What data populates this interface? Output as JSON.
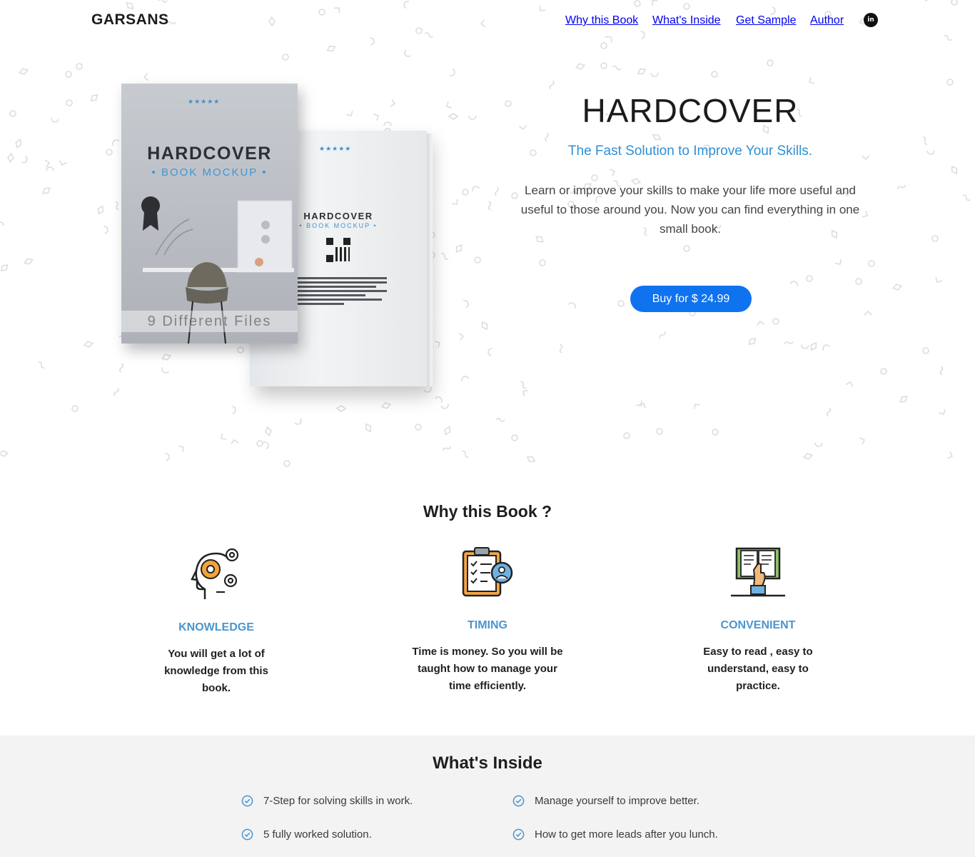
{
  "header": {
    "brand": "GARSANS",
    "nav": [
      "Why this Book",
      "What's Inside",
      "Get Sample",
      "Author"
    ],
    "social_icon": "linkedin-icon"
  },
  "hero": {
    "title": "HARDCOVER",
    "tagline": "The Fast Solution to Improve Your Skills.",
    "description": "Learn or improve your skills to make your life more useful and useful to those around you. Now you can find everything in one small book.",
    "buy_label": "Buy for $ 24.99",
    "accent": "#2f8fd6",
    "button_color": "#0f73ef",
    "book": {
      "front_title": "HARDCOVER",
      "front_sub": "• BOOK MOCKUP •",
      "front_files": "9 Different Files",
      "back_title": "HARDCOVER",
      "back_sub": "• BOOK MOCKUP •",
      "stars": "★★★★★"
    }
  },
  "why": {
    "title": "Why this Book ?",
    "features": [
      {
        "icon": "head-gears-icon",
        "title": "KNOWLEDGE",
        "desc": "You will get a lot of knowledge from this book."
      },
      {
        "icon": "clipboard-checklist-icon",
        "title": "TIMING",
        "desc": "Time is money. So you will be taught how to manage your time efficiently."
      },
      {
        "icon": "book-reading-icon",
        "title": "CONVENIENT",
        "desc": "Easy to read , easy to understand, easy to practice."
      }
    ]
  },
  "inside": {
    "title": "What's Inside",
    "items": [
      "7-Step for solving skills in work.",
      "Manage yourself to improve better.",
      "5 fully worked solution.",
      "How to get more leads after you lunch."
    ]
  }
}
